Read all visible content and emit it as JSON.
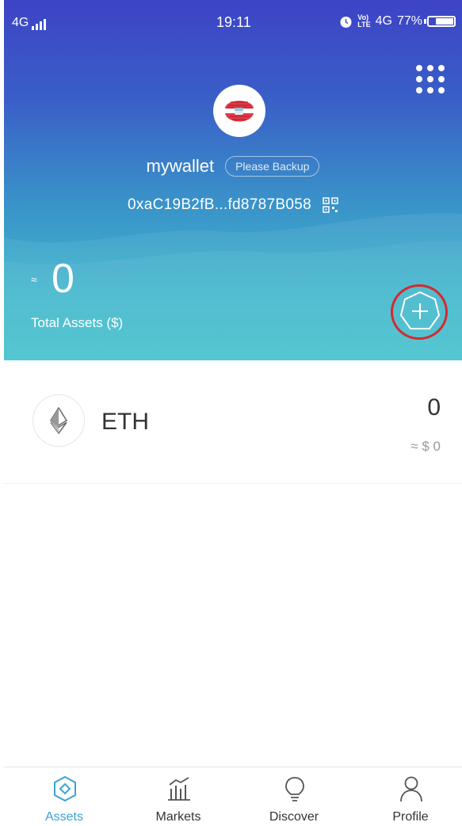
{
  "status_bar": {
    "network": "4G",
    "time": "19:11",
    "volte_top": "Vo)",
    "volte_bottom": "LTE",
    "network_right": "4G",
    "battery": "77%",
    "battery_level": 0.77
  },
  "header": {
    "wallet_name": "mywallet",
    "backup_label": "Please Backup",
    "address": "0xaC19B2fB...fd8787B058",
    "approx_symbol": "≈",
    "total_value": "0",
    "total_label": "Total Assets ($)",
    "icons": {
      "menu": "grid-menu-icon",
      "qr": "qr-code-icon",
      "add": "add-token-icon"
    }
  },
  "assets": [
    {
      "symbol": "ETH",
      "amount": "0",
      "fiat_value": "≈ $ 0",
      "icon": "ethereum-icon"
    }
  ],
  "tabbar": {
    "tabs": [
      {
        "label": "Assets",
        "icon": "assets-icon",
        "active": true
      },
      {
        "label": "Markets",
        "icon": "markets-icon",
        "active": false
      },
      {
        "label": "Discover",
        "icon": "lightbulb-icon",
        "active": false
      },
      {
        "label": "Profile",
        "icon": "profile-icon",
        "active": false
      }
    ]
  },
  "colors": {
    "header_gradient_top": "#3d43c6",
    "header_gradient_bottom": "#3ec0cc",
    "accent": "#3aa3d6",
    "annotation": "#d42a2f"
  }
}
